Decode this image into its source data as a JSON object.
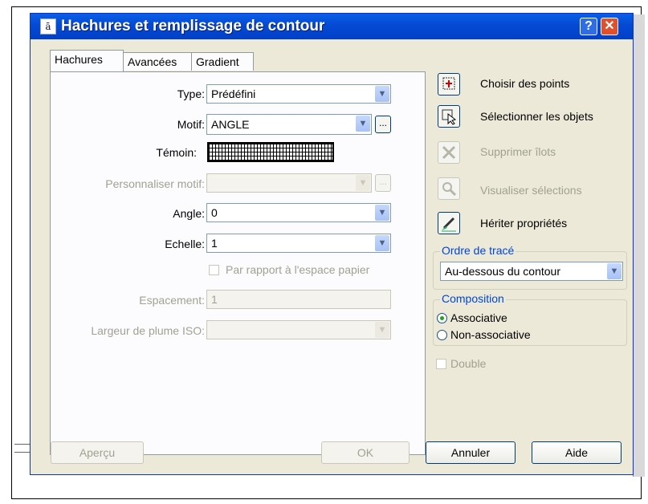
{
  "window": {
    "title": "Hachures et remplissage de contour",
    "help_label": "?",
    "close_label": "✕"
  },
  "tabs": [
    {
      "label": "Hachures",
      "active": true
    },
    {
      "label": "Avancées",
      "active": false
    },
    {
      "label": "Gradient",
      "active": false
    }
  ],
  "hatch": {
    "type_label": "Type:",
    "type_value": "Prédéfini",
    "motif_label": "Motif:",
    "motif_value": "ANGLE",
    "temoin_label": "Témoin:",
    "custom_label": "Personnaliser motif:",
    "custom_value": "",
    "angle_label": "Angle:",
    "angle_value": "0",
    "scale_label": "Echelle:",
    "scale_value": "1",
    "paper_space_label": "Par rapport à l'espace papier",
    "spacing_label": "Espacement:",
    "spacing_value": "1",
    "iso_label": "Largeur de plume ISO:",
    "iso_value": "",
    "ellipsis": "..."
  },
  "commands": [
    {
      "label": "Choisir des points",
      "icon": "pick-points-icon",
      "enabled": true
    },
    {
      "label": "Sélectionner les objets",
      "icon": "select-objects-icon",
      "enabled": true
    },
    {
      "label": "Supprimer îlots",
      "icon": "remove-islands-icon",
      "enabled": false
    },
    {
      "label": "Visualiser sélections",
      "icon": "view-selections-icon",
      "enabled": false
    },
    {
      "label": "Hériter propriétés",
      "icon": "inherit-properties-icon",
      "enabled": true
    }
  ],
  "draw_order": {
    "title": "Ordre de tracé",
    "value": "Au-dessous du contour"
  },
  "composition": {
    "title": "Composition",
    "options": [
      {
        "label": "Associative",
        "selected": true
      },
      {
        "label": "Non-associative",
        "selected": false
      }
    ]
  },
  "double_label": "Double",
  "buttons": {
    "preview": "Aperçu",
    "ok": "OK",
    "cancel": "Annuler",
    "help": "Aide"
  },
  "colors": {
    "titlebar": "#0449d4",
    "dialog": "#ece9d8",
    "accent": "#0046d5",
    "disabled": "#a1a192"
  }
}
